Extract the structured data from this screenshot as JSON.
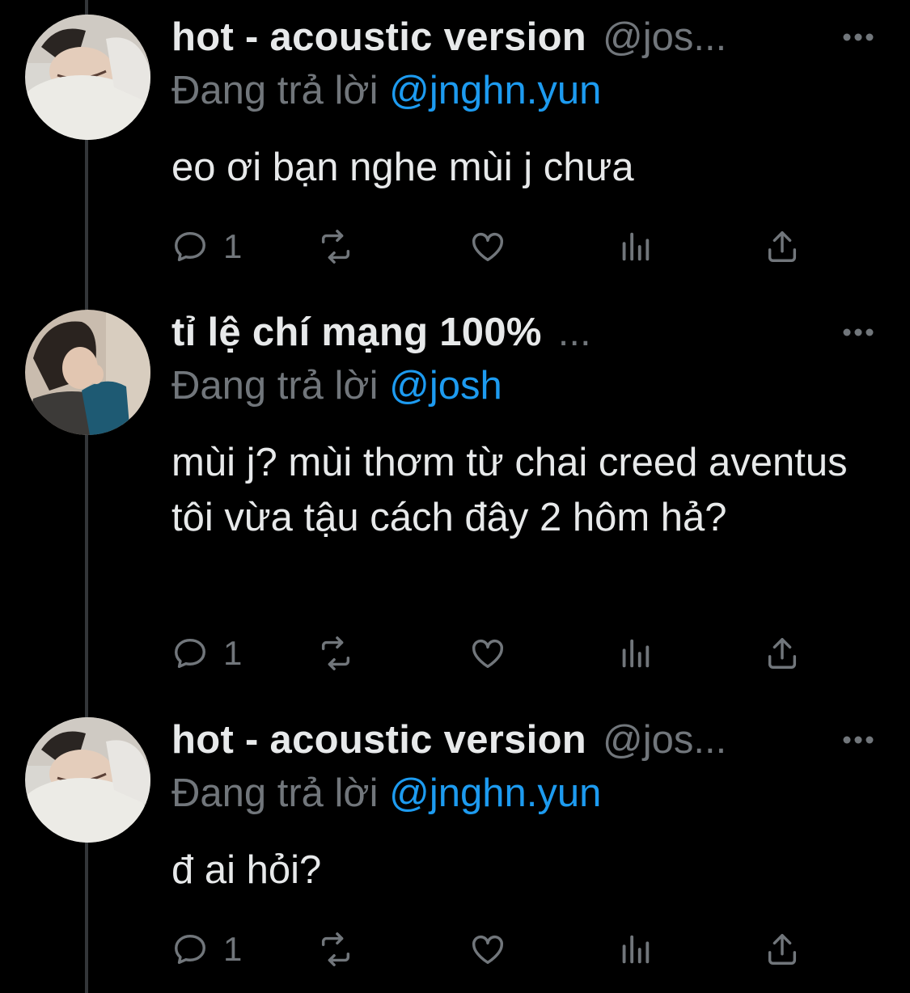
{
  "tweets": [
    {
      "name": "hot - acoustic version",
      "handle": "@jos...",
      "replying_prefix": "Đang trả lời",
      "replying_to": "@jnghn.yun",
      "text": "eo ơi bạn nghe mùi j chưa",
      "reply_count": "1"
    },
    {
      "name": "tỉ lệ chí mạng 100%",
      "handle": "...",
      "replying_prefix": "Đang trả lời",
      "replying_to": "@josh",
      "text": "mùi j? mùi thơm từ chai creed aventus tôi vừa tậu cách đây 2 hôm hả?",
      "reply_count": "1"
    },
    {
      "name": "hot - acoustic version",
      "handle": "@jos...",
      "replying_prefix": "Đang trả lời",
      "replying_to": "@jnghn.yun",
      "text": "đ ai hỏi?",
      "reply_count": "1"
    }
  ],
  "colors": {
    "background": "#000000",
    "text": "#e7e9ea",
    "muted": "#71767b",
    "link": "#1d9bf0",
    "thread_line": "#333639"
  },
  "icons": [
    "reply-icon",
    "retweet-icon",
    "like-icon",
    "views-icon",
    "share-icon",
    "more-icon"
  ]
}
